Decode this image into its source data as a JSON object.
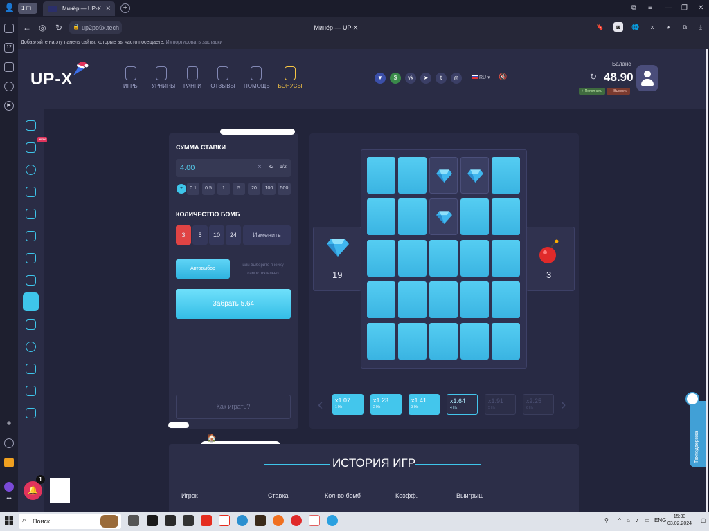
{
  "browser": {
    "tab_title": "Минёр — UP-X",
    "tab_count": "1",
    "url": "up2po9x.tech",
    "window_title": "Минёр — UP-X",
    "bookmarks_prompt": "Добавляйте на эту панель сайты, которые вы часто посещаете.",
    "bookmarks_import": "Импортировать закладки"
  },
  "site": {
    "logo": "UP-X",
    "nav": [
      {
        "label": "ИГРЫ"
      },
      {
        "label": "ТУРНИРЫ"
      },
      {
        "label": "РАНГИ"
      },
      {
        "label": "ОТЗЫВЫ"
      },
      {
        "label": "ПОМОЩЬ"
      },
      {
        "label": "БОНУСЫ"
      }
    ],
    "language": "RU",
    "balance_label": "Баланс",
    "balance_value": "48.90",
    "deposit_label": "+ Пополнить",
    "withdraw_label": "— Вывести",
    "new_badge": "NEW",
    "support_label": "Техподдержка",
    "notification_count": "1"
  },
  "bet": {
    "amount_label": "СУММА СТАВКИ",
    "amount_value": "4.00",
    "clear": "×",
    "double": "x2",
    "half": "1/2",
    "quick_amounts": [
      "0.1",
      "0.5",
      "1",
      "5",
      "20",
      "100",
      "500"
    ],
    "bombs_label": "КОЛИЧЕСТВО БОМБ",
    "bomb_options": [
      "3",
      "5",
      "10",
      "24"
    ],
    "selected_bombs": "3",
    "change_label": "Изменить",
    "auto_label": "Автовыбор",
    "auto_hint": "или выберите ячейку самостоятельно",
    "collect_label": "Забрать 5.64",
    "how_to_play": "Как играть?"
  },
  "game": {
    "gems_left": "19",
    "bombs_count": "3",
    "grid_rows": 5,
    "grid_cols": 5,
    "opened_cells": [
      [
        0,
        2
      ],
      [
        0,
        3
      ],
      [
        1,
        2
      ]
    ],
    "multipliers": [
      {
        "value": "x1.07",
        "step": "1 Нх",
        "state": "done"
      },
      {
        "value": "x1.23",
        "step": "2 Нх",
        "state": "done"
      },
      {
        "value": "x1.41",
        "step": "3 Нх",
        "state": "done"
      },
      {
        "value": "x1.64",
        "step": "4 Нх",
        "state": "current"
      },
      {
        "value": "x1.91",
        "step": "5 Нх",
        "state": "next"
      },
      {
        "value": "x2.25",
        "step": "6 Нх",
        "state": "next"
      }
    ]
  },
  "history": {
    "title": "ИСТОРИЯ ИГР",
    "columns": [
      "Игрок",
      "Ставка",
      "Кол-во бомб",
      "Коэфф.",
      "Выигрыш"
    ]
  },
  "taskbar": {
    "search_placeholder": "Поиск",
    "lang": "ENG",
    "time": "15:33",
    "date": "03.02.2024"
  },
  "colors": {
    "accent": "#3ec5ea",
    "gold": "#f6c544",
    "danger": "#e04444",
    "bg": "#22243a",
    "panel": "#2c2e48"
  }
}
